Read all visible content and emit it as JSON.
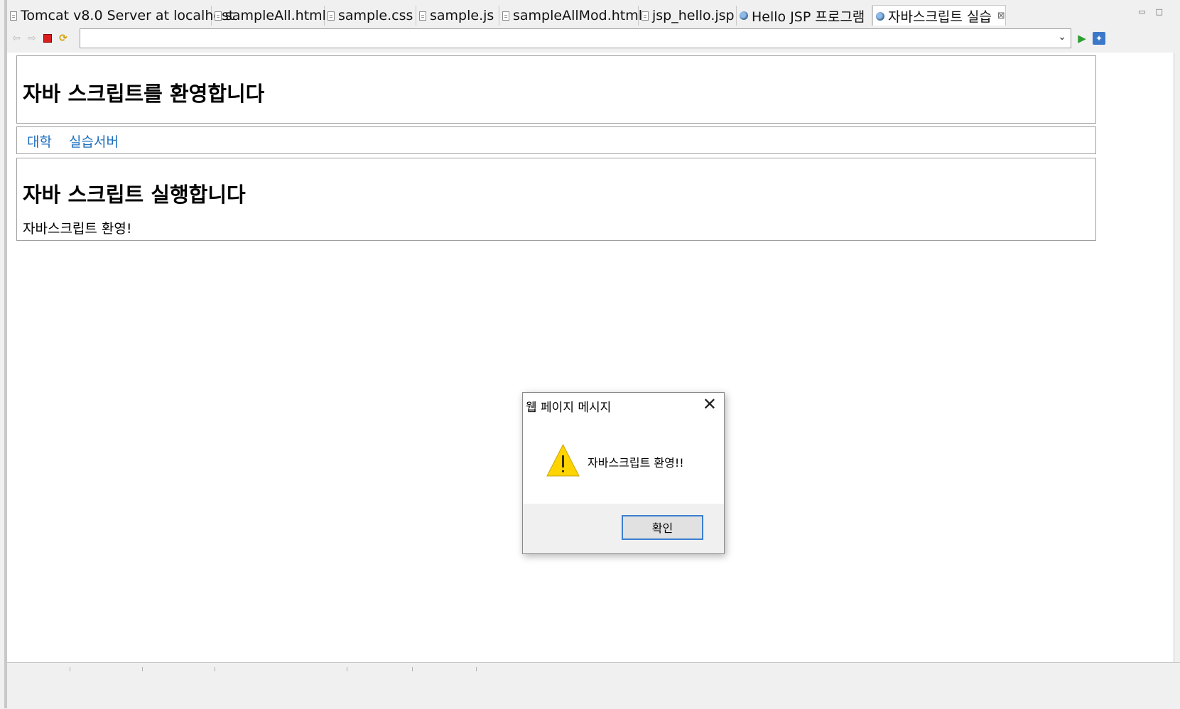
{
  "tabs": [
    {
      "label": "Tomcat v8.0 Server at localhost",
      "icon": "server-icon"
    },
    {
      "label": "sampleAll.html",
      "icon": "file-icon"
    },
    {
      "label": "sample.css",
      "icon": "file-icon"
    },
    {
      "label": "sample.js",
      "icon": "js-file-icon"
    },
    {
      "label": "sampleAllMod.html",
      "icon": "file-icon"
    },
    {
      "label": "jsp_hello.jsp",
      "icon": "file-icon"
    },
    {
      "label": "Hello JSP 프로그램",
      "icon": "globe-icon"
    },
    {
      "label": "자바스크립트 실습",
      "icon": "globe-icon",
      "active": true,
      "close": "⊠"
    }
  ],
  "toolbar": {
    "url_value": ""
  },
  "page": {
    "heading1": "자바 스크립트를 환영합니다",
    "nav": [
      "대학",
      "실습서버"
    ],
    "heading2": "자바 스크립트 실행합니다",
    "paragraph": "자바스크립트 환영!"
  },
  "dialog": {
    "title": "웹 페이지 메시지",
    "message": "자바스크립트 환영!!",
    "ok_label": "확인"
  },
  "colors": {
    "link": "#1f6fbf",
    "warning": "#ffd400",
    "button_focus": "#3c7fd1"
  }
}
